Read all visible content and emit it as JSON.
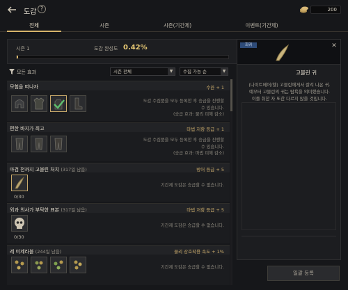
{
  "header": {
    "title": "도감",
    "help_symbol": "?",
    "currency_value": "200",
    "back_icon": "back-arrow-icon",
    "currency_icon": "coin-stack-icon"
  },
  "tabs": [
    {
      "label": "전체",
      "active": true
    },
    {
      "label": "시즌",
      "active": false
    },
    {
      "label": "시즌(기간제)",
      "active": false
    },
    {
      "label": "이벤트(기간제)",
      "active": false
    }
  ],
  "season": {
    "label": "시즌 1",
    "completion_label": "도감 완성도",
    "completion_value": "0.42%",
    "progress_percent": 0.42
  },
  "filters": {
    "effect_label": "모든 효과",
    "season_select": "시즌 전체",
    "sort_select": "수집 가능 순"
  },
  "groups": [
    {
      "name": "모험을 떠나자",
      "days": "",
      "effect": "수완 + 1",
      "desc_lines": [
        "도감 수집품을 모두 등록한 후 승급을 진행할",
        "수 있습니다.",
        "(승급 효과: 물리 피해 감소)"
      ],
      "items": [
        "helmet",
        "armor",
        "glove-selected",
        "boots"
      ],
      "count": ""
    },
    {
      "name": "편한 바지가 최고",
      "days": "",
      "effect": "마법 저항 등급 + 1",
      "desc_lines": [
        "도감 수집품을 모두 등록한 후 승급을 진행할",
        "수 있습니다.",
        "(승급 효과: 마법 피해 감소)"
      ],
      "items": [
        "pants-1",
        "pants-2",
        "pants-3"
      ],
      "count": ""
    },
    {
      "name": "마검 전까지 고블린 처치",
      "days": "(317일 남음)",
      "effect": "방어 등급 + 5",
      "desc_lines": [
        "기간제 도감은 승급할 수 없습니다."
      ],
      "items": [
        "goblin-ear"
      ],
      "count": "0/30"
    },
    {
      "name": "외과 의사가 부탁한 표본",
      "days": "(317일 남음)",
      "effect": "마법 저항 등급 + 5",
      "desc_lines": [
        "기간제 도감은 승급할 수 없습니다."
      ],
      "items": [
        "skull"
      ],
      "count": "0/30"
    },
    {
      "name": "레 미제라블",
      "days": "(244일 남음)",
      "effect": "물리 상호작용 속도 + 1%",
      "desc_lines": [
        "기간제 도감은 승급할 수 없습니다."
      ],
      "items": [
        "flower-1",
        "flower-2",
        "flower-3",
        "flower-4"
      ],
      "count": ""
    }
  ],
  "detail": {
    "badge": "희귀",
    "name": "고블린 귀",
    "desc_lines": [
      "(나이트메어/헬) 고블린에게서 잘려 나온 귀.",
      "예부터 고블린의 귀는 탐욕을 의미했습니다.",
      "이를 취한 자 또한 다르지 않을 것입니다."
    ],
    "close_symbol": "✕",
    "icon": "goblin-ear-icon"
  },
  "register_button": "일괄 등록",
  "colors": {
    "accent": "#d8b56b",
    "completion": "#e6c874",
    "badge_bg": "#2e4b78",
    "background": "#16171a"
  }
}
